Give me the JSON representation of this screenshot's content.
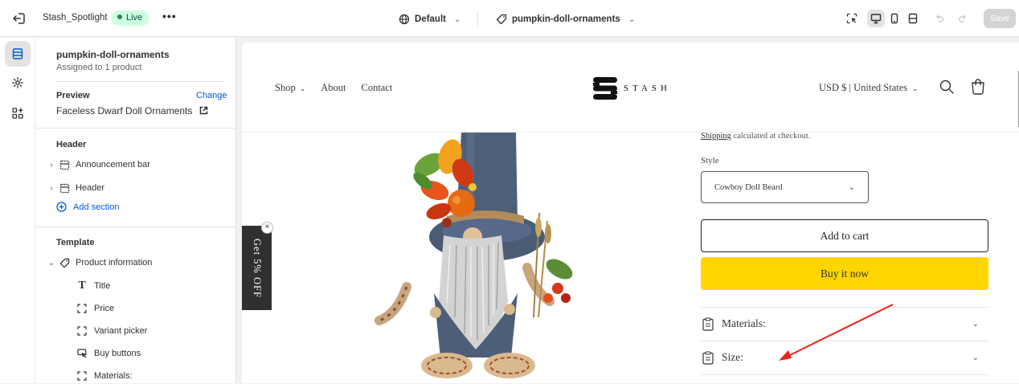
{
  "topbar": {
    "store_name": "Stash_Spotlight",
    "status_badge": "Live",
    "more_label": "•••",
    "theme_name": "Default",
    "template_name": "pumpkin-doll-ornaments",
    "save_label": "Save"
  },
  "sidebar": {
    "template_title": "pumpkin-doll-ornaments",
    "template_subtitle": "Assigned to 1 product",
    "preview_label": "Preview",
    "change_label": "Change",
    "preview_product": "Faceless Dwarf Doll Ornaments",
    "header_group": {
      "title": "Header",
      "items": [
        {
          "label": "Announcement bar"
        },
        {
          "label": "Header"
        }
      ],
      "add_section_label": "Add section"
    },
    "template_group": {
      "title": "Template",
      "section_label": "Product information",
      "blocks": [
        {
          "label": "Title"
        },
        {
          "label": "Price"
        },
        {
          "label": "Variant picker"
        },
        {
          "label": "Buy buttons"
        },
        {
          "label": "Materials:"
        }
      ]
    }
  },
  "store": {
    "nav": {
      "shop": "Shop",
      "about": "About",
      "contact": "Contact"
    },
    "logo_text": "STASH",
    "currency": "USD $ | United States",
    "promo_tab": "Get 5% OFF",
    "promo_close": "×",
    "shipping_link": "Shipping",
    "shipping_rest": " calculated at checkout.",
    "style_label": "Style",
    "style_value": "Cowboy Doll Beard",
    "add_to_cart": "Add to cart",
    "buy_now": "Buy it now",
    "accordions": [
      {
        "label": "Materials:"
      },
      {
        "label": "Size:"
      }
    ]
  },
  "colors": {
    "accent_blue": "#005bd3",
    "live_badge_bg": "#cdfee1",
    "buy_now_yellow": "#ffd600",
    "annotation_arrow": "#e8231d"
  }
}
